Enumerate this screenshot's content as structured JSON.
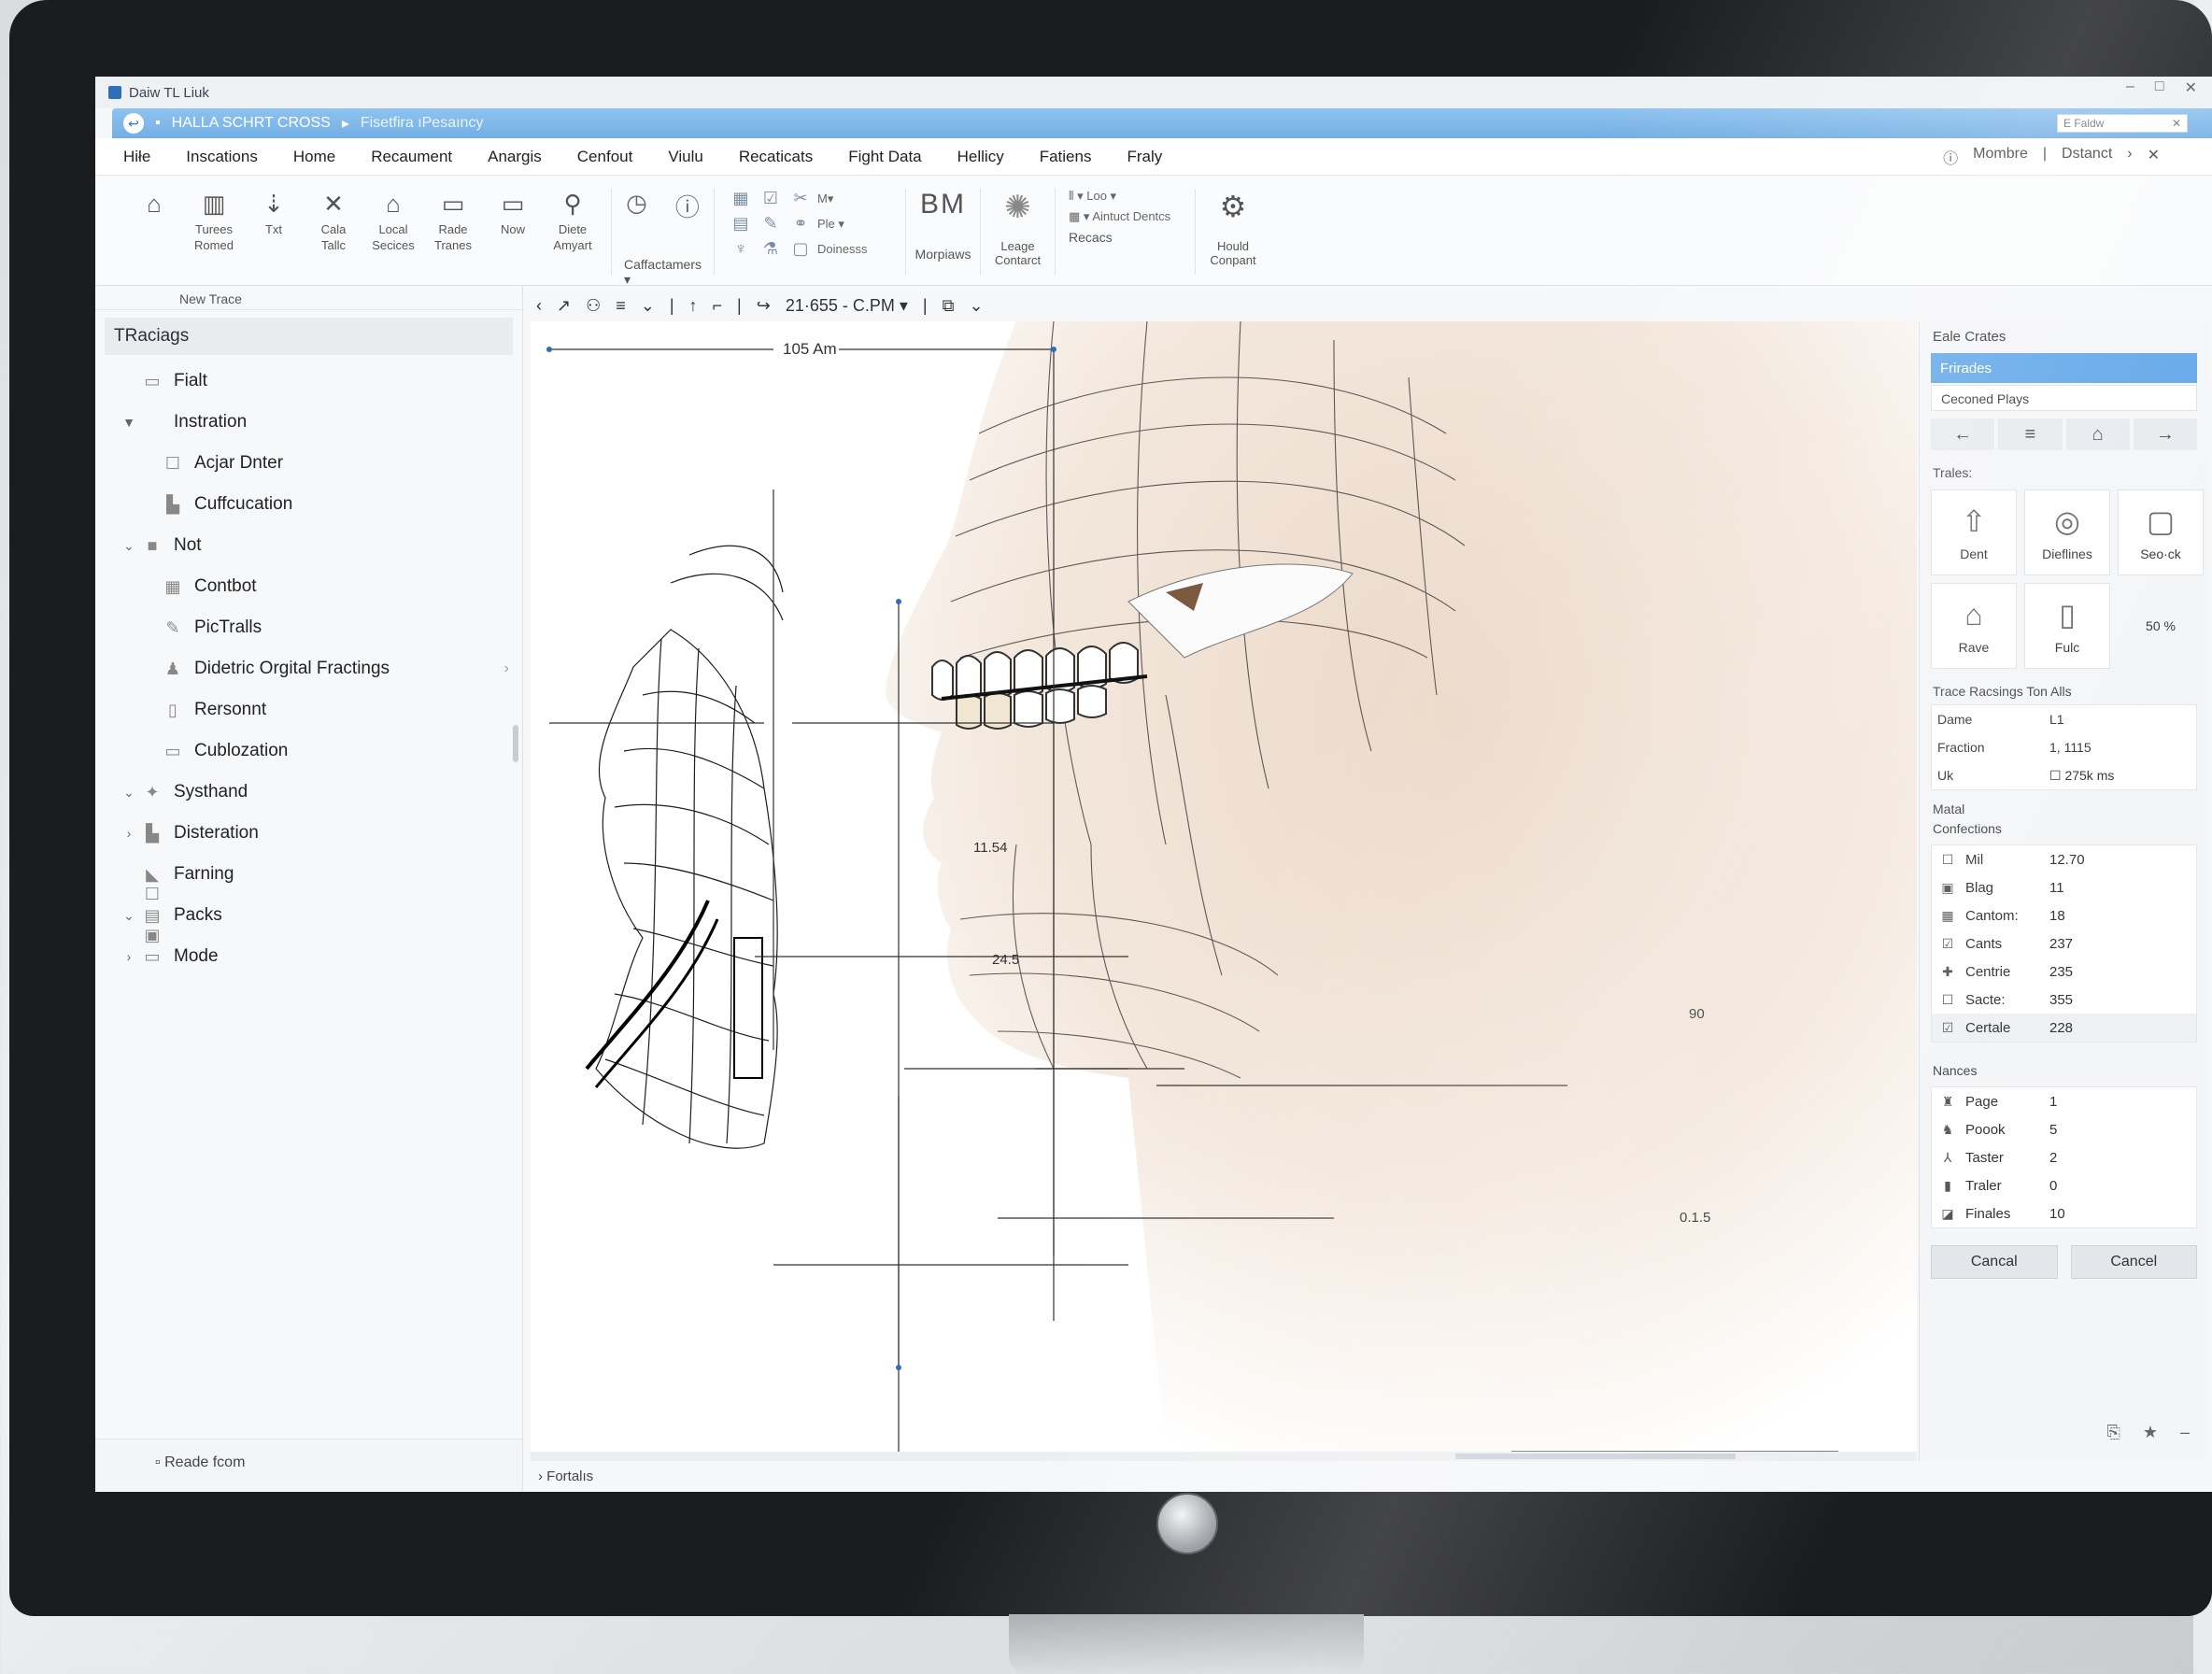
{
  "app": {
    "title": "Daiw TL Liuk",
    "tab_title": "HALLA SCHRT CROSS",
    "tab_sub": "Fisetfira ıPesaıncy",
    "search_placeholder": "E Faldw",
    "win_controls": [
      "–",
      "□",
      "✕"
    ]
  },
  "menu": {
    "items": [
      "Hiłe",
      "Inscations",
      "Home",
      "Recaument",
      "Anargis",
      "Cenfout",
      "Viulu",
      "Recaticats",
      "Fight Data",
      "Hellicy",
      "Fatiens",
      "Fraly"
    ],
    "right": [
      "Mombre",
      "Dstanct"
    ]
  },
  "ribbon": {
    "buttons": [
      {
        "icon": "⌂",
        "label": ""
      },
      {
        "icon": "▥",
        "label": "Turees Romed"
      },
      {
        "icon": "⇣",
        "label": "Txt"
      },
      {
        "icon": "✕",
        "label": "Cala Tallc"
      },
      {
        "icon": "⌂",
        "label": "Local Secices"
      },
      {
        "icon": "▭",
        "label": "Rade Tranes"
      },
      {
        "icon": "▭",
        "label": "Now"
      },
      {
        "icon": "⚲",
        "label": "Diete Amyart"
      }
    ],
    "group2_label": "Caffactamers ▾",
    "grid_labels": [
      "M▾",
      "Ple ▾",
      "Doinesss"
    ],
    "bm_label": "BM",
    "morpiaws_label": "Morpiaws",
    "leage_label": "Leage Contarct",
    "recacs_row": [
      "Loo ▾",
      "▾ Aintuct Dentcs"
    ],
    "recacs_label": "Recacs",
    "hould_label": "Hould Conpant",
    "caption": "New Trace"
  },
  "toolbar2": {
    "time_label": "21·655 - C.PM ▾"
  },
  "left_panel": {
    "header": "TRaciags",
    "items": [
      {
        "level": "top",
        "chev": "",
        "icon": "▭",
        "label": "Fialt"
      },
      {
        "level": "top",
        "chev": "▼",
        "icon": "",
        "label": "Instration"
      },
      {
        "level": "sub",
        "chev": "",
        "icon": "☐",
        "label": "Acjar Dnter"
      },
      {
        "level": "sub",
        "chev": "",
        "icon": "▙",
        "label": "Cuffcucation"
      },
      {
        "level": "top",
        "chev": "⌄",
        "icon": "■",
        "label": "Not"
      },
      {
        "level": "sub",
        "chev": "",
        "icon": "▦",
        "label": "Contbot"
      },
      {
        "level": "sub",
        "chev": "",
        "icon": "✎",
        "label": "PicTralls"
      },
      {
        "level": "sub",
        "chev": "",
        "icon": "♟",
        "label": "Didetric Orgital Fractings",
        "arrow": "›"
      },
      {
        "level": "sub",
        "chev": "",
        "icon": "▯",
        "label": "Rersonnt"
      },
      {
        "level": "sub",
        "chev": "",
        "icon": "▭",
        "label": "Cublozation"
      },
      {
        "level": "top",
        "chev": "⌄",
        "icon": "✦",
        "label": "Systhand"
      },
      {
        "level": "top",
        "chev": "›",
        "icon": "▙",
        "label": "Disteration"
      },
      {
        "level": "top",
        "chev": "",
        "icon": "◣ ☐",
        "label": "Farning"
      },
      {
        "level": "top",
        "chev": "⌄",
        "icon": "▤ ▣",
        "label": "Packs"
      },
      {
        "level": "top",
        "chev": "›",
        "icon": "▭",
        "label": "Mode"
      }
    ],
    "footer": "Reade fcom"
  },
  "canvas": {
    "dim_top": "105 Am",
    "dim_left": "11.54",
    "dim_mid": "24.5",
    "dim_right": "90",
    "dim_low": "0.1.5"
  },
  "status": {
    "label": "Fortalıs"
  },
  "right_panel": {
    "title": "Eale Crates",
    "selected": "Frirades",
    "sub": "Ceconed Plays",
    "nav": [
      "←",
      "≡",
      "⌂",
      "→"
    ],
    "trales_label": "Trales:",
    "tiles": [
      {
        "icon": "⇧",
        "label": "Dent"
      },
      {
        "icon": "◎",
        "label": "Dieflines"
      },
      {
        "icon": "▢",
        "label": "Seo·ck"
      },
      {
        "icon": "⌂",
        "label": "Rave"
      },
      {
        "icon": "▯",
        "label": "Fulc"
      },
      {
        "icon": "",
        "label": "50 %"
      }
    ],
    "trace_label": "Trace Racsings  Ton  Alls",
    "kv": [
      {
        "k": "Dame",
        "v": "L1"
      },
      {
        "k": "Fraction",
        "v": "1,  1115"
      },
      {
        "k": "Uk",
        "v": "☐  275k ms"
      }
    ],
    "matal_label": "Matal",
    "confections_label": "Confections",
    "matal_list": [
      {
        "icon": "☐",
        "name": "Mil",
        "val": "12.70"
      },
      {
        "icon": "▣",
        "name": "Blag",
        "val": "11"
      },
      {
        "icon": "▦",
        "name": "Cantom:",
        "val": "18"
      },
      {
        "icon": "☑",
        "name": "Cants",
        "val": "237"
      },
      {
        "icon": "✚",
        "name": "Centrie",
        "val": "235"
      },
      {
        "icon": "☐",
        "name": "Sacte:",
        "val": "355"
      },
      {
        "icon": "☑",
        "name": "Certale",
        "val": "228"
      }
    ],
    "nances_label": "Nances",
    "nances_list": [
      {
        "icon": "♜",
        "name": "Page",
        "val": "1"
      },
      {
        "icon": "♞",
        "name": "Poook",
        "val": "5"
      },
      {
        "icon": "⅄",
        "name": "Taster",
        "val": "2"
      },
      {
        "icon": "▮",
        "name": "Traler",
        "val": "0"
      },
      {
        "icon": "◪",
        "name": "Finales",
        "val": "10"
      }
    ],
    "btn_ok": "Cancal",
    "btn_cancel": "Cancel"
  }
}
